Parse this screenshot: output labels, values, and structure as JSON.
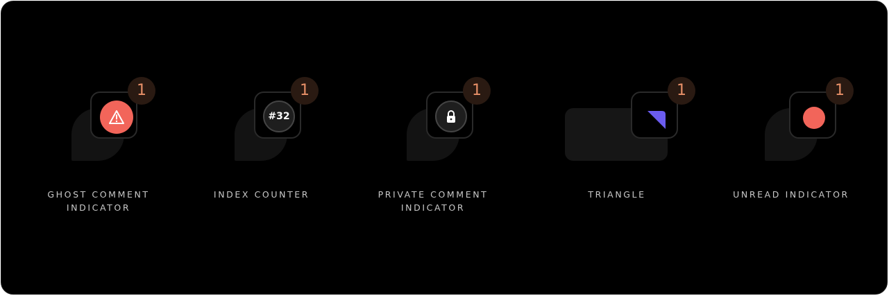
{
  "items": [
    {
      "label_line1": "GHOST COMMENT",
      "label_line2": "INDICATOR",
      "badge_count": "1",
      "icon": "warning-icon"
    },
    {
      "label_line1": "INDEX COUNTER",
      "badge_count": "1",
      "counter_text": "#32"
    },
    {
      "label_line1": "PRIVATE COMMENT",
      "label_line2": "INDICATOR",
      "badge_count": "1",
      "icon": "lock-icon"
    },
    {
      "label_line1": "TRIANGLE",
      "badge_count": "1",
      "icon": "triangle-icon"
    },
    {
      "label_line1": "UNREAD INDICATOR",
      "badge_count": "1",
      "icon": "dot-icon"
    }
  ],
  "colors": {
    "background": "#000000",
    "badge_bg": "#2a1a12",
    "badge_text": "#e89068",
    "accent_red": "#f2655a",
    "accent_purple": "#6b5cf0",
    "label_text": "#c8c8c8"
  }
}
